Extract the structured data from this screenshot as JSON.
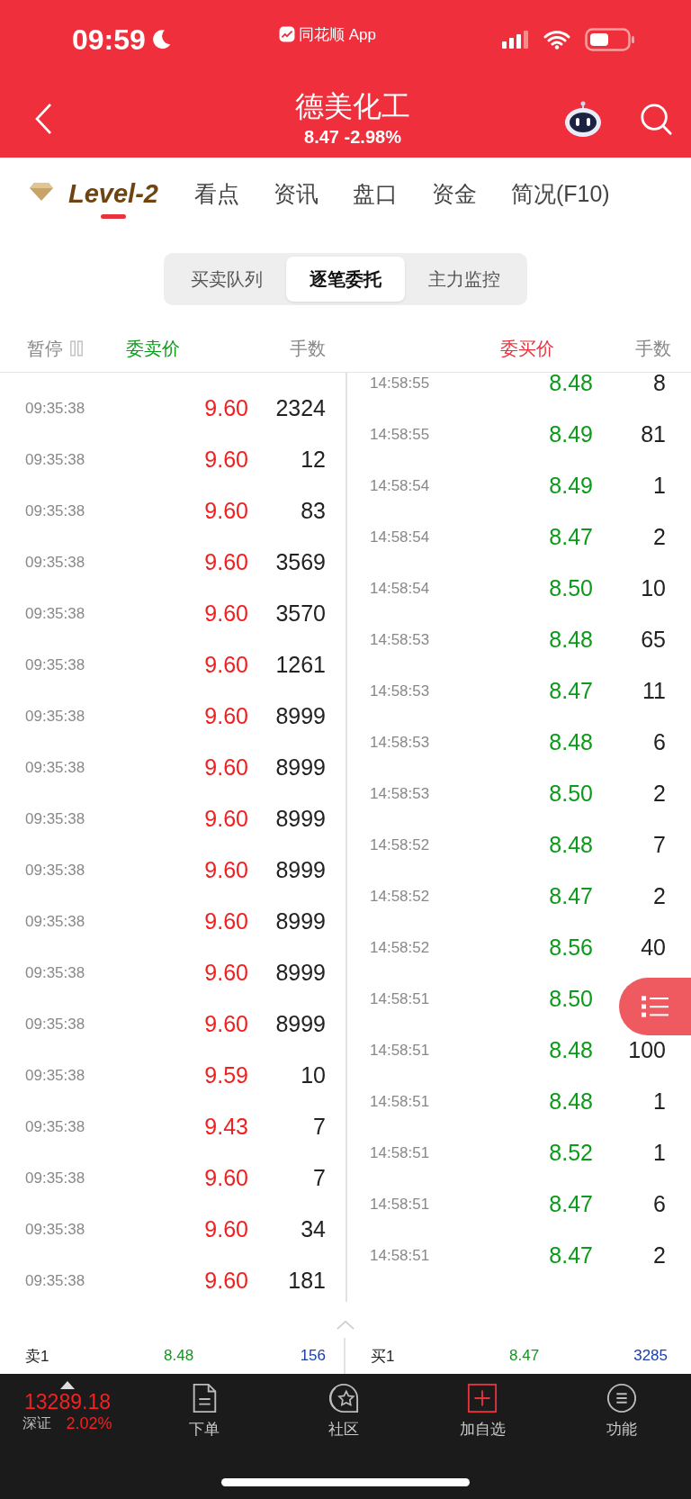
{
  "status_bar": {
    "time": "09:59",
    "app": "同花顺 App"
  },
  "header": {
    "title": "德美化工",
    "subtitle": "8.47 -2.98%"
  },
  "tabs": [
    {
      "label": "Level-2",
      "selected": true
    },
    {
      "label": "看点",
      "selected": false
    },
    {
      "label": "资讯",
      "selected": false
    },
    {
      "label": "盘口",
      "selected": false
    },
    {
      "label": "资金",
      "selected": false
    },
    {
      "label": "简况(F10)",
      "selected": false
    }
  ],
  "segments": [
    {
      "label": "买卖队列",
      "selected": false
    },
    {
      "label": "逐笔委托",
      "selected": true
    },
    {
      "label": "主力监控",
      "selected": false
    }
  ],
  "columns": {
    "pause": "暂停",
    "sell_price": "委卖价",
    "sell_qty": "手数",
    "buy_price": "委买价",
    "buy_qty": "手数"
  },
  "sell_orders": [
    {
      "time": "09:35:38",
      "price": "9.60",
      "qty": "2324"
    },
    {
      "time": "09:35:38",
      "price": "9.60",
      "qty": "12"
    },
    {
      "time": "09:35:38",
      "price": "9.60",
      "qty": "83"
    },
    {
      "time": "09:35:38",
      "price": "9.60",
      "qty": "3569"
    },
    {
      "time": "09:35:38",
      "price": "9.60",
      "qty": "3570"
    },
    {
      "time": "09:35:38",
      "price": "9.60",
      "qty": "1261"
    },
    {
      "time": "09:35:38",
      "price": "9.60",
      "qty": "8999"
    },
    {
      "time": "09:35:38",
      "price": "9.60",
      "qty": "8999"
    },
    {
      "time": "09:35:38",
      "price": "9.60",
      "qty": "8999"
    },
    {
      "time": "09:35:38",
      "price": "9.60",
      "qty": "8999"
    },
    {
      "time": "09:35:38",
      "price": "9.60",
      "qty": "8999"
    },
    {
      "time": "09:35:38",
      "price": "9.60",
      "qty": "8999"
    },
    {
      "time": "09:35:38",
      "price": "9.60",
      "qty": "8999"
    },
    {
      "time": "09:35:38",
      "price": "9.59",
      "qty": "10"
    },
    {
      "time": "09:35:38",
      "price": "9.43",
      "qty": "7"
    },
    {
      "time": "09:35:38",
      "price": "9.60",
      "qty": "7"
    },
    {
      "time": "09:35:38",
      "price": "9.60",
      "qty": "34"
    },
    {
      "time": "09:35:38",
      "price": "9.60",
      "qty": "181"
    }
  ],
  "buy_orders": [
    {
      "time": "14:58:55",
      "price": "8.48",
      "qty": "8"
    },
    {
      "time": "14:58:55",
      "price": "8.49",
      "qty": "81"
    },
    {
      "time": "14:58:54",
      "price": "8.49",
      "qty": "1"
    },
    {
      "time": "14:58:54",
      "price": "8.47",
      "qty": "2"
    },
    {
      "time": "14:58:54",
      "price": "8.50",
      "qty": "10"
    },
    {
      "time": "14:58:53",
      "price": "8.48",
      "qty": "65"
    },
    {
      "time": "14:58:53",
      "price": "8.47",
      "qty": "11"
    },
    {
      "time": "14:58:53",
      "price": "8.48",
      "qty": "6"
    },
    {
      "time": "14:58:53",
      "price": "8.50",
      "qty": "2"
    },
    {
      "time": "14:58:52",
      "price": "8.48",
      "qty": "7"
    },
    {
      "time": "14:58:52",
      "price": "8.47",
      "qty": "2"
    },
    {
      "time": "14:58:52",
      "price": "8.56",
      "qty": "40"
    },
    {
      "time": "14:58:51",
      "price": "8.50"
    },
    {
      "time": "14:58:51",
      "price": "8.48",
      "qty": "100"
    },
    {
      "time": "14:58:51",
      "price": "8.48",
      "qty": "1"
    },
    {
      "time": "14:58:51",
      "price": "8.52",
      "qty": "1"
    },
    {
      "time": "14:58:51",
      "price": "8.47",
      "qty": "6"
    },
    {
      "time": "14:58:51",
      "price": "8.47",
      "qty": "2"
    }
  ],
  "best_quotes": [
    {
      "label": "卖1",
      "price": "8.48",
      "qty": "156"
    },
    {
      "label": "买1",
      "price": "8.47",
      "qty": "3285"
    }
  ],
  "bottom_bar": {
    "index": {
      "value": "13289.18",
      "name": "深证",
      "change": "2.02%"
    },
    "items": [
      {
        "label": "下单",
        "kind": "order"
      },
      {
        "label": "社区",
        "kind": "community"
      },
      {
        "label": "加自选",
        "kind": "add"
      },
      {
        "label": "功能",
        "kind": "menu"
      }
    ]
  }
}
